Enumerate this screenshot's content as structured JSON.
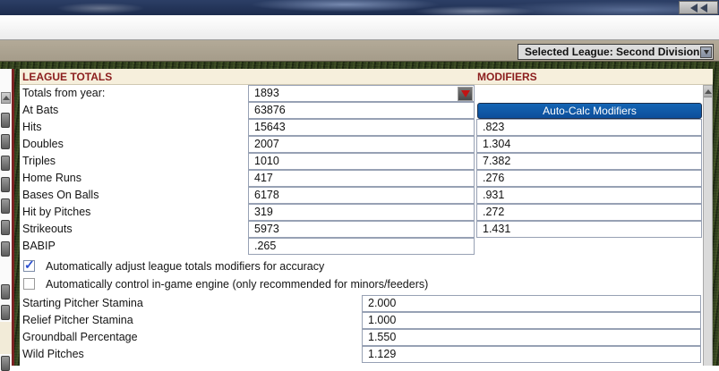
{
  "toolbar": {
    "selected_league_label": "Selected League: Second Division"
  },
  "panel": {
    "headers": {
      "left": "LEAGUE TOTALS",
      "right": "MODIFIERS"
    },
    "year_row": {
      "label": "Totals from year:",
      "value": "1893"
    },
    "auto_calc_button": "Auto-Calc Modifiers",
    "stat_rows": [
      {
        "label": "At Bats",
        "value": "63876",
        "modifier": null,
        "has_button": true
      },
      {
        "label": "Hits",
        "value": "15643",
        "modifier": ".823",
        "has_button": false
      },
      {
        "label": "Doubles",
        "value": "2007",
        "modifier": "1.304",
        "has_button": false
      },
      {
        "label": "Triples",
        "value": "1010",
        "modifier": "7.382",
        "has_button": false
      },
      {
        "label": "Home Runs",
        "value": "417",
        "modifier": ".276",
        "has_button": false
      },
      {
        "label": "Bases On Balls",
        "value": "6178",
        "modifier": ".931",
        "has_button": false
      },
      {
        "label": "Hit by Pitches",
        "value": "319",
        "modifier": ".272",
        "has_button": false
      },
      {
        "label": "Strikeouts",
        "value": "5973",
        "modifier": "1.431",
        "has_button": false
      },
      {
        "label": "BABIP",
        "value": ".265",
        "modifier": null,
        "has_button": false
      }
    ],
    "checkbox_rows": [
      {
        "label": "Automatically adjust league totals modifiers for accuracy",
        "checked": true
      },
      {
        "label": "Automatically control in-game engine (only recommended for minors/feeders)",
        "checked": false
      }
    ],
    "engine_rows": [
      {
        "label": "Starting Pitcher Stamina",
        "value": "2.000"
      },
      {
        "label": "Relief Pitcher Stamina",
        "value": "1.000"
      },
      {
        "label": "Groundball Percentage",
        "value": "1.550"
      },
      {
        "label": "Wild Pitches",
        "value": "1.129"
      }
    ],
    "check_glyph": "✓"
  },
  "icons": {
    "collapse": "double-left-chevron-icon",
    "league_dropdown": "down-arrow-icon",
    "year_dropdown": "red-down-arrow-icon",
    "scroll_up": "up-arrow-icon",
    "checkmark": "check-icon"
  },
  "colors": {
    "accent_maroon": "#8b1d1d",
    "header_cream": "#f6efdc",
    "button_blue": "#0d56a8",
    "panel_green": "#2e3b1d",
    "toolbar_taupe": "#aba28f",
    "check_blue": "#2b4fd0",
    "field_border": "#97a1b4"
  }
}
